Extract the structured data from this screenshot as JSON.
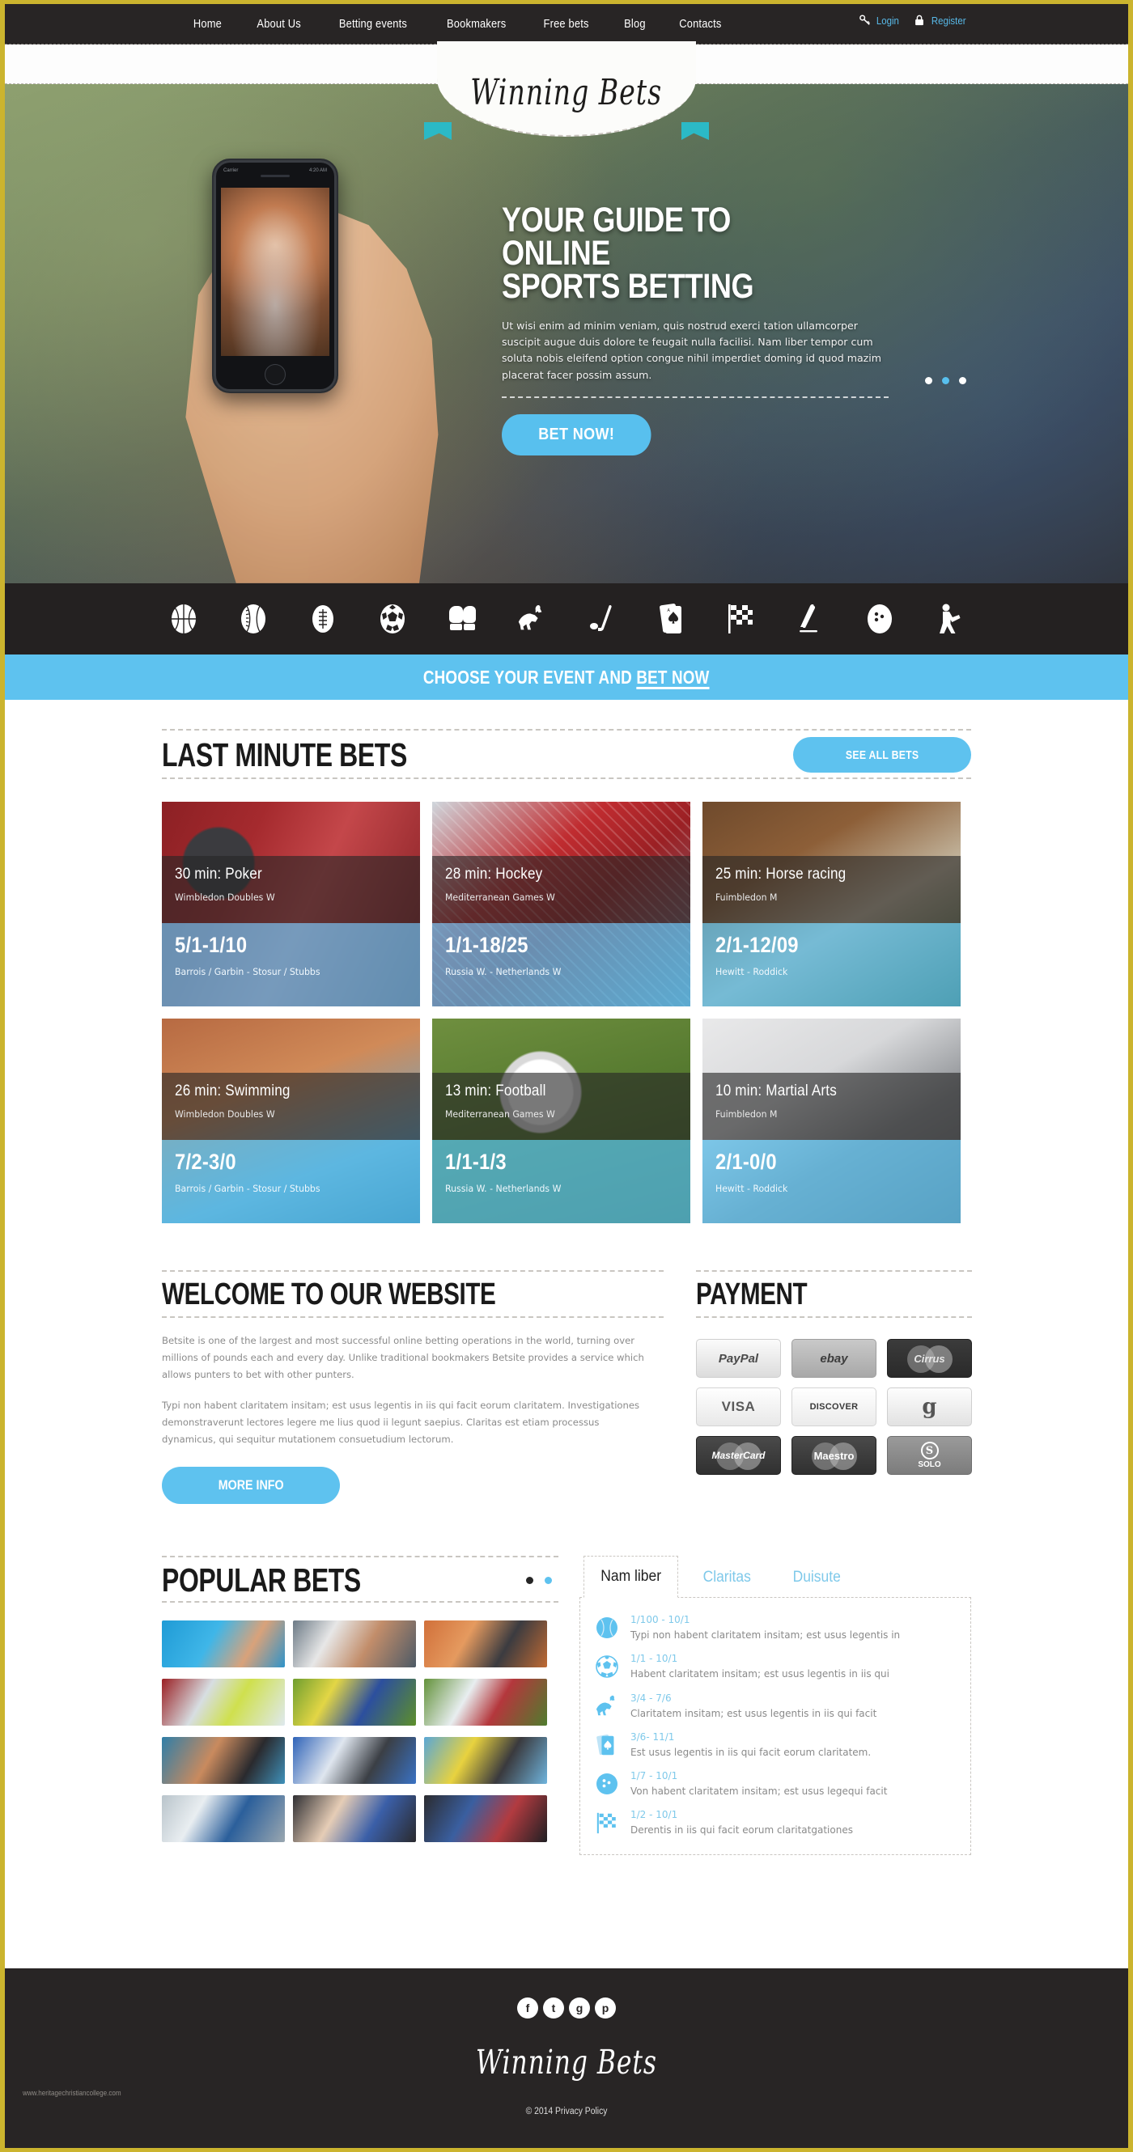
{
  "brand": {
    "name": "Winning Bets",
    "footer_name": "Winning Bets"
  },
  "topnav": {
    "items": [
      {
        "label": "Home"
      },
      {
        "label": "About Us"
      },
      {
        "label": "Betting events"
      },
      {
        "label": "Bookmakers"
      },
      {
        "label": "Free bets"
      },
      {
        "label": "Blog"
      },
      {
        "label": "Contacts"
      }
    ],
    "login_label": "Login",
    "register_label": "Register",
    "login_icon": "key-icon",
    "register_icon": "lock-icon"
  },
  "hero": {
    "title_line1": "YOUR GUIDE TO ONLINE",
    "title_line2": "SPORTS BETTING",
    "description": "Ut wisi enim ad minim veniam, quis nostrud exerci tation ullamcorper suscipit  augue duis dolore te feugait nulla facilisi. Nam liber tempor cum soluta nobis eleifend option congue nihil imperdiet doming id quod mazim placerat facer possim assum.",
    "cta_label": "BET NOW!",
    "slide_count": 3,
    "active_slide": 2,
    "phone_time": "4:20 AM",
    "phone_carrier": "Carrier"
  },
  "sportbar": {
    "icons": [
      "basketball-icon",
      "baseball-icon",
      "american-football-icon",
      "soccer-icon",
      "boxing-gloves-icon",
      "horse-racing-icon",
      "golf-icon",
      "cards-icon",
      "racing-flag-icon",
      "ice-skate-icon",
      "bowling-icon",
      "martial-arts-icon"
    ]
  },
  "bluestrip": {
    "text_before": "CHOOSE YOUR EVENT AND ",
    "text_link": "BET NOW"
  },
  "last_minute": {
    "title": "LAST MINUTE BETS",
    "see_all_label": "SEE ALL BETS",
    "cards": [
      {
        "title": "30 min: Poker",
        "league": "Wimbledon Doubles W",
        "odds": "5/1-1/10",
        "players": "Barrois / Garbin - Stosur / Stubbs",
        "photo": "ph-poker"
      },
      {
        "title": "28 min: Hockey",
        "league": "Mediterranean Games W",
        "odds": "1/1-18/25",
        "players": "Russia W. - Netherlands W",
        "photo": "ph-hockey"
      },
      {
        "title": "25 min: Horse racing",
        "league": "Fuimbledon M",
        "odds": "2/1-12/09",
        "players": "Hewitt - Roddick",
        "photo": "ph-horse"
      },
      {
        "title": "26 min: Swimming",
        "league": "Wimbledon Doubles W",
        "odds": "7/2-3/0",
        "players": "Barrois / Garbin - Stosur / Stubbs",
        "photo": "ph-swim"
      },
      {
        "title": "13 min: Football",
        "league": "Mediterranean Games W",
        "odds": "1/1-1/3",
        "players": "Russia W. - Netherlands W",
        "photo": "ph-foot"
      },
      {
        "title": "10 min: Martial Arts",
        "league": "Fuimbledon M",
        "odds": "2/1-0/0",
        "players": "Hewitt - Roddick",
        "photo": "ph-martial"
      }
    ]
  },
  "welcome": {
    "title": "WELCOME TO OUR  WEBSITE",
    "paragraph1": "Betsite is one of the largest and most successful online betting operations in the world, turning over millions of pounds each and every day. Unlike traditional bookmakers Betsite provides a service which allows punters to bet with other punters.",
    "paragraph2": "Typi non habent claritatem insitam; est usus legentis in iis qui facit eorum claritatem. Investigationes demonstraverunt lectores legere me lius quod ii legunt saepius. Claritas est etiam processus dynamicus, qui sequitur mutationem consuetudium lectorum.",
    "more_label": "MORE INFO"
  },
  "payment": {
    "title": "PAYMENT",
    "methods": [
      {
        "label": "PayPal",
        "cls": "pc-paypal"
      },
      {
        "label": "ebay",
        "cls": "pc-ebay"
      },
      {
        "label": "Cirrus",
        "cls": "pc-cirrus"
      },
      {
        "label": "VISA",
        "cls": "pc-visa"
      },
      {
        "label": "DISCOVER",
        "cls": "pc-discover"
      },
      {
        "label": "g",
        "cls": "pc-google"
      },
      {
        "label": "MasterCard",
        "cls": "pc-mastercard"
      },
      {
        "label": "Maestro",
        "cls": "pc-maestro"
      },
      {
        "label": "SOLO",
        "cls": "pc-solo"
      }
    ]
  },
  "popular": {
    "title": "POPULAR BETS",
    "dots": 2,
    "active_dot": 2,
    "thumbs": [
      {
        "name": "swimming-thumb",
        "cls": "th1"
      },
      {
        "name": "judo-thumb",
        "cls": "th2"
      },
      {
        "name": "cycling-thumb",
        "cls": "th3"
      },
      {
        "name": "tennis-thumb",
        "cls": "th4"
      },
      {
        "name": "football-thumb",
        "cls": "th5"
      },
      {
        "name": "field-hockey-thumb",
        "cls": "th6"
      },
      {
        "name": "swimmer-thumb",
        "cls": "th7"
      },
      {
        "name": "running-thumb",
        "cls": "th8"
      },
      {
        "name": "motocross-thumb",
        "cls": "th9"
      },
      {
        "name": "water-sport-thumb",
        "cls": "th10"
      },
      {
        "name": "fans-thumb",
        "cls": "th11"
      },
      {
        "name": "boxing-thumb",
        "cls": "th12"
      }
    ],
    "tabs": [
      {
        "label": "Nam liber",
        "active": true
      },
      {
        "label": "Claritas",
        "active": false
      },
      {
        "label": "Duisute",
        "active": false
      }
    ],
    "items": [
      {
        "icon": "baseball-icon",
        "odds": "1/100 - 10/1",
        "text": "Typi non habent claritatem insitam; est usus legentis in"
      },
      {
        "icon": "soccer-icon",
        "odds": "1/1 - 10/1",
        "text": "Habent claritatem insitam; est usus legentis in iis qui"
      },
      {
        "icon": "horse-racing-icon",
        "odds": "3/4 - 7/6",
        "text": "Claritatem insitam; est usus legentis in iis qui facit"
      },
      {
        "icon": "cards-icon",
        "odds": "3/6- 11/1",
        "text": "Est usus legentis in iis qui facit eorum claritatem."
      },
      {
        "icon": "bowling-icon",
        "odds": "1/7 - 10/1",
        "text": "Von habent claritatem insitam; est usus legequi facit"
      },
      {
        "icon": "racing-flag-icon",
        "odds": "1/2 - 10/1",
        "text": "Derentis in iis qui facit eorum claritatgationes"
      }
    ]
  },
  "footer": {
    "social": [
      {
        "name": "facebook-icon",
        "glyph": "f"
      },
      {
        "name": "twitter-icon",
        "glyph": "t"
      },
      {
        "name": "google-plus-icon",
        "glyph": "g"
      },
      {
        "name": "pinterest-icon",
        "glyph": "p"
      }
    ],
    "copyright": "© 2014   Privacy Policy",
    "watermark": "www.heritagechristiancollege.com"
  },
  "colors": {
    "accent": "#5ec2ef",
    "dark": "#282525",
    "border": "#cbb42e",
    "teal": "#2bb9c6"
  }
}
